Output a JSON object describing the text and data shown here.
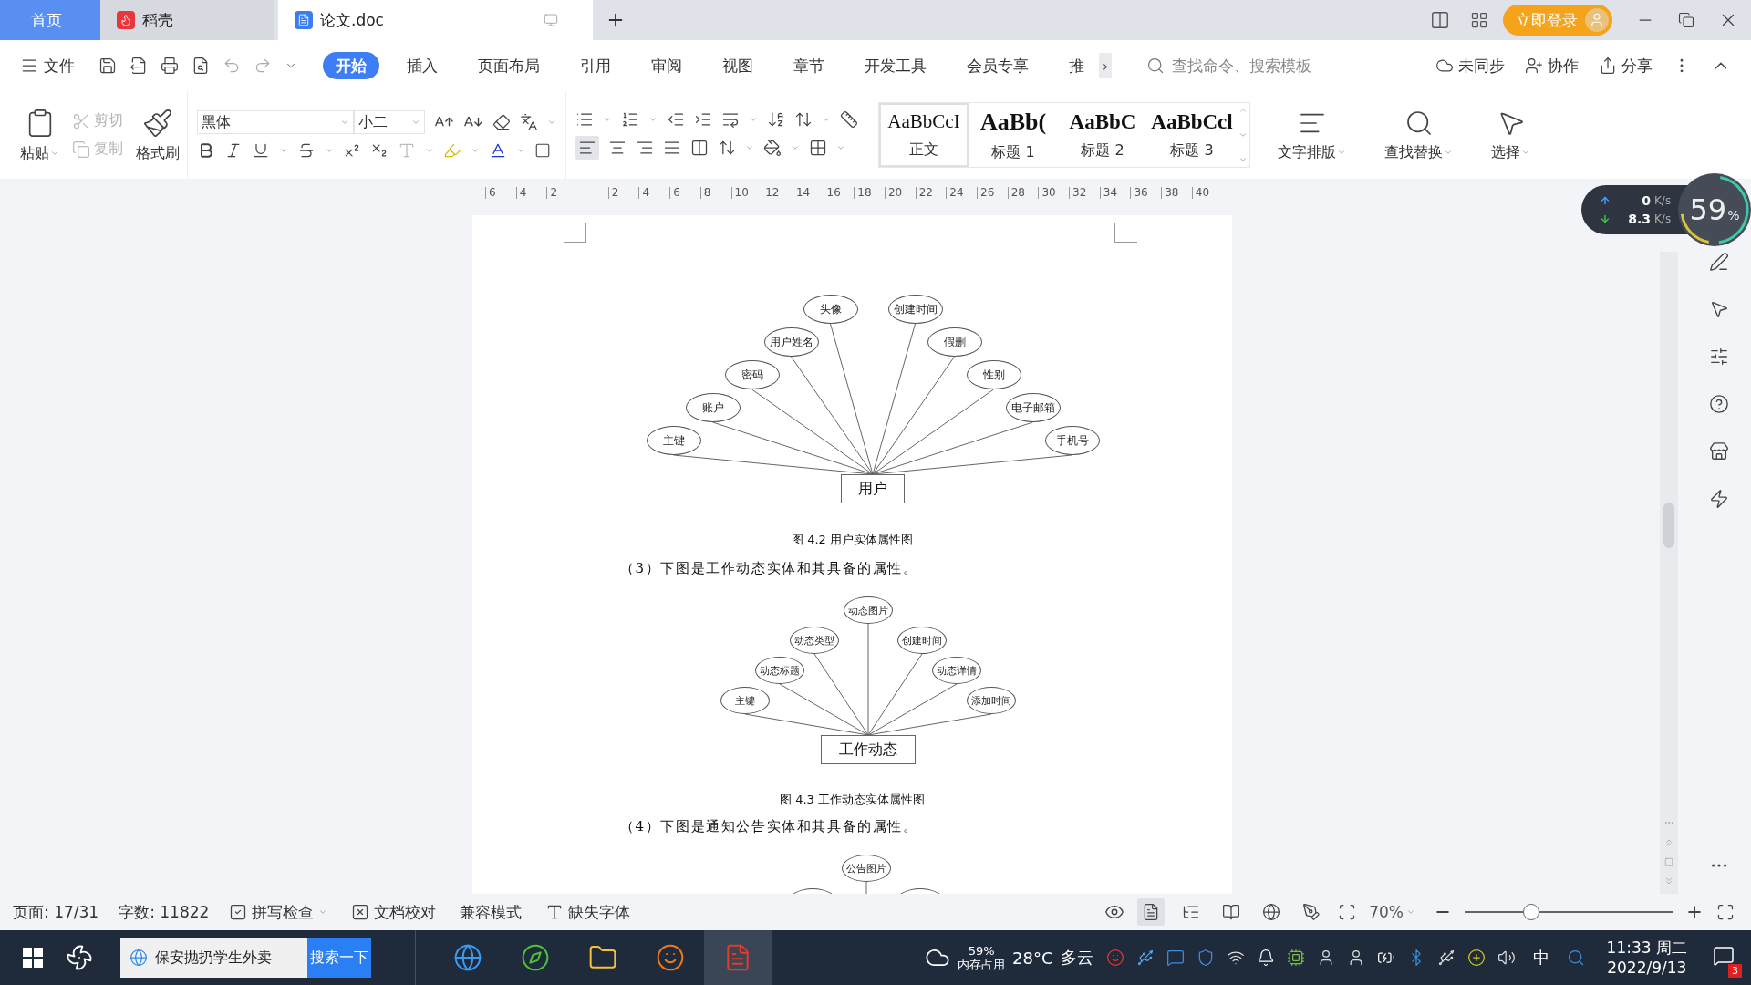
{
  "tabs": [
    {
      "label": "首页",
      "kind": "home",
      "selected": false
    },
    {
      "label": "稻壳",
      "kind": "docer",
      "selected": false
    },
    {
      "label": "论文.doc",
      "kind": "doc",
      "selected": true
    }
  ],
  "login": {
    "label": "立即登录"
  },
  "menu": {
    "file": "文件",
    "tabs": [
      {
        "label": "开始",
        "selected": true
      },
      {
        "label": "插入",
        "selected": false
      },
      {
        "label": "页面布局",
        "selected": false
      },
      {
        "label": "引用",
        "selected": false
      },
      {
        "label": "审阅",
        "selected": false
      },
      {
        "label": "视图",
        "selected": false
      },
      {
        "label": "章节",
        "selected": false
      },
      {
        "label": "开发工具",
        "selected": false
      },
      {
        "label": "会员专享",
        "selected": false
      },
      {
        "label": "推",
        "selected": false
      }
    ],
    "more": "›",
    "search": {
      "placeholder": "查找命令、搜索模板"
    },
    "actions": [
      "未同步",
      "协作",
      "分享"
    ]
  },
  "ribbon": {
    "paste": "粘贴",
    "cut": {
      "label": "剪切",
      "disabled": true
    },
    "copy": {
      "label": "复制",
      "disabled": true
    },
    "format_painter": "格式刷",
    "font": "黑体",
    "size": "小二",
    "styles": [
      {
        "preview": "AaBbCcI",
        "label": "正文",
        "selected": true
      },
      {
        "preview": "AaBb(",
        "label": "标题 1",
        "selected": false
      },
      {
        "preview": "AaBbC",
        "label": "标题 2",
        "selected": false
      },
      {
        "preview": "AaBbCcl",
        "label": "标题 3",
        "selected": false
      }
    ],
    "tools": [
      "文字排版",
      "查找替换",
      "选择"
    ]
  },
  "ruler": {
    "numbers": [
      "6",
      "4",
      "2",
      "2",
      "4",
      "6",
      "8",
      "10",
      "12",
      "14",
      "16",
      "18",
      "20",
      "22",
      "24",
      "26",
      "28",
      "30",
      "32",
      "34",
      "36",
      "38",
      "40"
    ]
  },
  "document": {
    "blocks": [
      {
        "kind": "diagram",
        "entity": "用户",
        "nodes": [
          {
            "label": "主键"
          },
          {
            "label": "账户"
          },
          {
            "label": "密码"
          },
          {
            "label": "用户姓名"
          },
          {
            "label": "头像"
          },
          {
            "label": "创建时间"
          },
          {
            "label": "假删"
          },
          {
            "label": "性别"
          },
          {
            "label": "电子邮箱"
          },
          {
            "label": "手机号"
          }
        ]
      },
      {
        "kind": "caption",
        "text": "图 4.2 用户实体属性图"
      },
      {
        "kind": "paragraph",
        "text": "（3）下图是工作动态实体和其具备的属性。"
      },
      {
        "kind": "diagram",
        "entity": "工作动态",
        "nodes": [
          {
            "label": "主键"
          },
          {
            "label": "动态标题"
          },
          {
            "label": "动态类型"
          },
          {
            "label": "动态图片"
          },
          {
            "label": "创建时间"
          },
          {
            "label": "动态详情"
          },
          {
            "label": "添加时间"
          }
        ]
      },
      {
        "kind": "caption",
        "text": "图 4.3 工作动态实体属性图"
      },
      {
        "kind": "paragraph",
        "text": "（4）下图是通知公告实体和其具备的属性。"
      },
      {
        "kind": "diagram",
        "nodes": [
          {
            "kind": "blank"
          },
          {
            "label": "公告图片"
          },
          {
            "kind": "blank"
          }
        ]
      }
    ]
  },
  "network": {
    "up": "0",
    "up_unit": "K/s",
    "down": "8.3",
    "down_unit": "K/s",
    "memory": "59",
    "memory_unit": "%"
  },
  "status_bar": {
    "page": "页面: 17/31",
    "words": "字数: 11822",
    "spell": "拼写检查",
    "proof": "文档校对",
    "compat": "兼容模式",
    "missing_font": "缺失字体",
    "view_modes": [
      {
        "selected": true
      },
      {
        "selected": false
      },
      {
        "selected": false
      },
      {
        "selected": false
      },
      {
        "selected": false
      }
    ],
    "zoom": "70%",
    "zoom_slider": {
      "level": 0.32
    }
  },
  "taskbar": {
    "search": {
      "value": "保安抛扔学生外卖",
      "button": "搜索一下"
    },
    "weather": {
      "temp": "28°C",
      "condition": "多云"
    },
    "memory": {
      "value": "59%",
      "label": "内存占用"
    },
    "ime": "中",
    "time": "11:33 周二",
    "date": "2022/9/13",
    "badge": "3"
  }
}
